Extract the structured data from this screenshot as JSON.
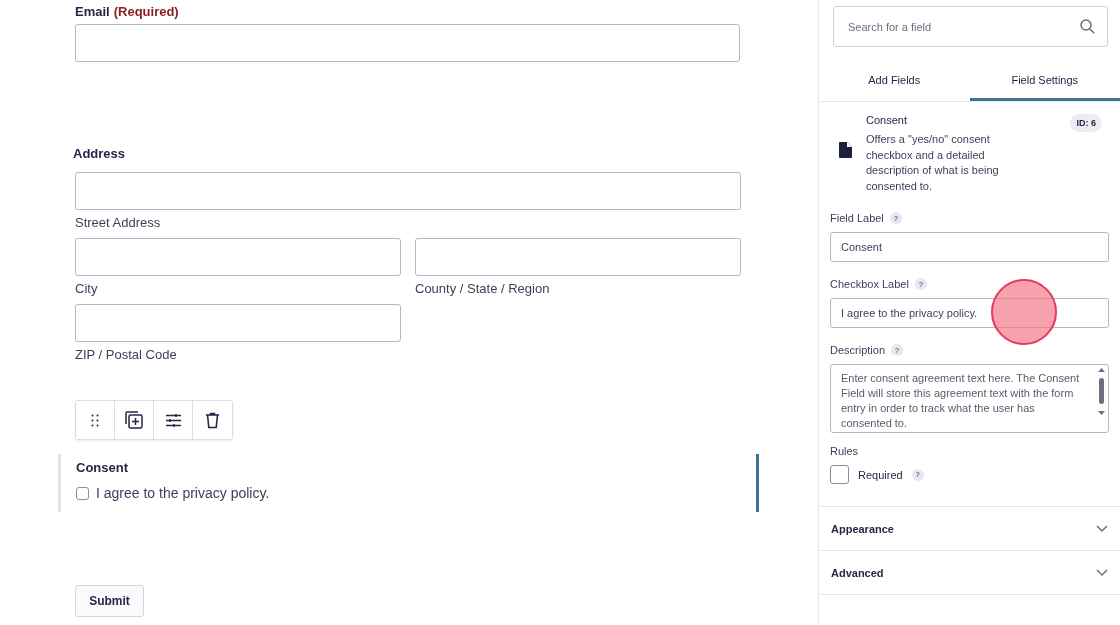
{
  "form": {
    "email": {
      "label": "Email",
      "required_note": "(Required)"
    },
    "address": {
      "label": "Address",
      "sublabels": [
        "Street Address",
        "City",
        "County / State / Region",
        "ZIP / Postal Code"
      ]
    },
    "consent": {
      "label": "Consent",
      "checkbox_label": "I agree to the privacy policy.",
      "checked": false,
      "selected": true
    },
    "submit": "Submit"
  },
  "panel": {
    "search": {
      "placeholder": "Search for a field"
    },
    "tabs": [
      {
        "label": "Add Fields",
        "selected": false
      },
      {
        "label": "Field Settings",
        "selected": true
      }
    ],
    "field_info": {
      "title": "Consent",
      "badge": "ID: 6",
      "description": "Offers a \"yes/no\" consent checkbox and a detailed description of what is being consented to."
    },
    "settings": [
      {
        "kind": "input",
        "label": "Field Label",
        "help": "?",
        "value": "Consent"
      },
      {
        "kind": "input",
        "label": "Checkbox Label",
        "help": "?",
        "value": "I agree to the privacy policy."
      },
      {
        "kind": "textarea",
        "label": "Description",
        "help": "?",
        "value": "Enter consent agreement text here.  The Consent Field will store this agreement text with the form entry in order to track what the user has consented to."
      }
    ],
    "rules": {
      "label": "Rules",
      "checkbox": {
        "label": "Required",
        "help": "?",
        "checked": false
      }
    },
    "sections": [
      {
        "label": "Appearance",
        "expanded": false
      },
      {
        "label": "Advanced",
        "expanded": false
      }
    ]
  }
}
